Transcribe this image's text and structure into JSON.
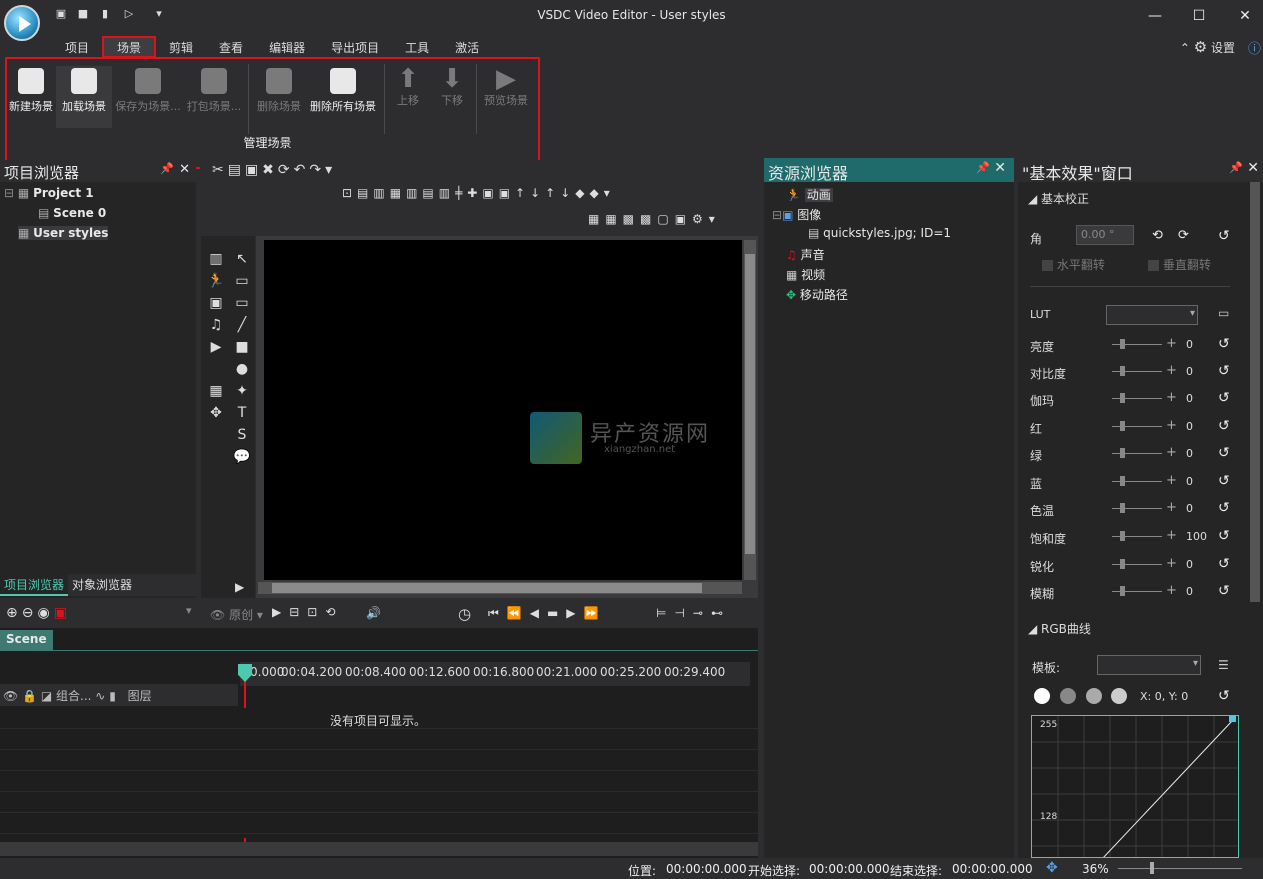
{
  "window": {
    "title": "VSDC Video Editor - User styles",
    "minimize": "—",
    "maximize": "☐",
    "close": "✕"
  },
  "menu": [
    "项目",
    "场景",
    "剪辑",
    "查看",
    "编辑器",
    "导出项目",
    "工具",
    "激活"
  ],
  "settings_label": "设置",
  "ribbon": {
    "buttons": [
      {
        "label": "新建场景",
        "enabled": true
      },
      {
        "label": "加载场景",
        "enabled": true
      },
      {
        "label": "保存为场景...",
        "enabled": false
      },
      {
        "label": "打包场景...",
        "enabled": false
      },
      {
        "label": "删除场景",
        "enabled": false
      },
      {
        "label": "删除所有场景",
        "enabled": true
      },
      {
        "label": "上移",
        "enabled": false
      },
      {
        "label": "下移",
        "enabled": false
      },
      {
        "label": "预览场景",
        "enabled": false
      }
    ],
    "group_label": "管理场景"
  },
  "project_explorer": {
    "title": "项目浏览器",
    "items": [
      "Project 1",
      "Scene 0",
      "User styles"
    ],
    "tabs": [
      "项目浏览器",
      "对象浏览器"
    ]
  },
  "resource_explorer": {
    "title": "资源浏览器",
    "items": [
      "动画",
      "图像",
      "quickstyles.jpg; ID=1",
      "声音",
      "视频",
      "移动路径"
    ]
  },
  "effects": {
    "title": "\"基本效果\"窗口",
    "section1": "基本校正",
    "angle_label": "角",
    "angle_value": "0.00 °",
    "flip_h": "水平翻转",
    "flip_v": "垂直翻转",
    "lut_label": "LUT",
    "rows": [
      {
        "label": "亮度",
        "value": "0"
      },
      {
        "label": "对比度",
        "value": "0"
      },
      {
        "label": "伽玛",
        "value": "0"
      },
      {
        "label": "红",
        "value": "0"
      },
      {
        "label": "绿",
        "value": "0"
      },
      {
        "label": "蓝",
        "value": "0"
      },
      {
        "label": "色温",
        "value": "0"
      },
      {
        "label": "饱和度",
        "value": "100"
      },
      {
        "label": "锐化",
        "value": "0"
      },
      {
        "label": "模糊",
        "value": "0"
      }
    ],
    "section2": "RGB曲线",
    "template_label": "模板:",
    "coords": "X: 0, Y: 0",
    "curve_max": "255",
    "curve_mid": "128"
  },
  "preview": {
    "mode_label": "原创",
    "watermark": "异产资源网",
    "watermark_sub": "xiangzhan.net"
  },
  "timeline": {
    "tab": "Scene",
    "ruler": [
      "0.000",
      "00:04.200",
      "00:08.400",
      "00:12.600",
      "00:16.800",
      "00:21.000",
      "00:25.200",
      "00:29.400"
    ],
    "col_group": "组合...",
    "col_layer": "图层",
    "empty": "没有项目可显示。"
  },
  "status": {
    "pos_label": "位置:",
    "pos": "00:00:00.000",
    "start_label": "开始选择:",
    "start": "00:00:00.000",
    "end_label": "结束选择:",
    "end": "00:00:00.000",
    "zoom": "36%"
  }
}
